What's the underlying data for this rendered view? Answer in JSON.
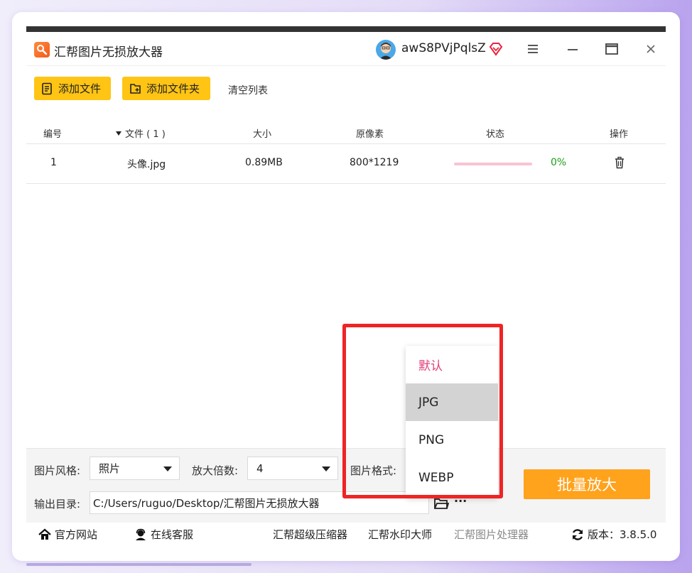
{
  "app": {
    "title": "汇帮图片无损放大器",
    "username": "awS8PVjPqlsZ"
  },
  "toolbar": {
    "add_file": "添加文件",
    "add_folder": "添加文件夹",
    "clear_list": "清空列表"
  },
  "table": {
    "headers": {
      "index": "编号",
      "file": "文件 ( 1 )",
      "size": "大小",
      "pixels": "原像素",
      "status": "状态",
      "action": "操作"
    },
    "rows": [
      {
        "index": "1",
        "file": "头像.jpg",
        "size": "0.89MB",
        "pixels": "800*1219",
        "progress": 0,
        "percent": "0%"
      }
    ]
  },
  "settings": {
    "style_label": "图片风格:",
    "style_value": "照片",
    "scale_label": "放大倍数:",
    "scale_value": "4",
    "format_label": "图片格式:",
    "output_label": "输出目录:",
    "output_path": "C:/Users/ruguo/Desktop/汇帮图片无损放大器",
    "more_label": "···",
    "batch_button": "批量放大"
  },
  "format_dropdown": {
    "options": [
      "默认",
      "JPG",
      "PNG",
      "WEBP"
    ],
    "highlighted": "JPG",
    "selected": "默认"
  },
  "footer": {
    "official_site": "官方网站",
    "online_service": "在线客服",
    "compressor": "汇帮超级压缩器",
    "watermark": "汇帮水印大师",
    "processor": "汇帮图片处理器",
    "version": "版本：3.8.5.0"
  },
  "colors": {
    "accent_yellow": "#ffc414",
    "batch_orange": "#ffa21c",
    "highlight_red": "#ef2424",
    "default_pink": "#e0407a",
    "percent_green": "#1aa01a"
  }
}
